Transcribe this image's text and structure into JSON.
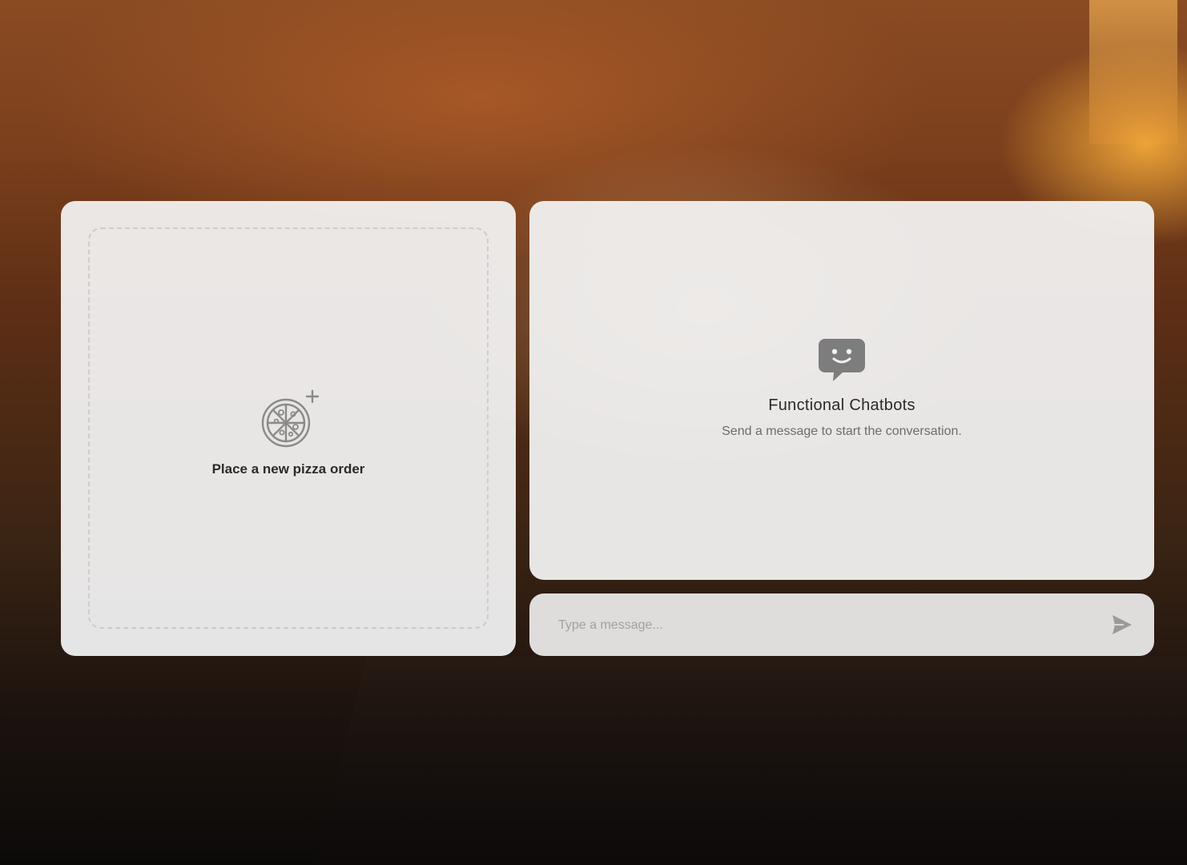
{
  "order_panel": {
    "label": "Place a new pizza order",
    "icon": "pizza-add-icon"
  },
  "chat_panel": {
    "icon": "chatbot-smile-icon",
    "title": "Functional Chatbots",
    "subtitle": "Send a message to start the conversation."
  },
  "composer": {
    "value": "",
    "placeholder": "Type a message...",
    "send_icon": "send-icon"
  },
  "colors": {
    "panel": "#f2f2f2",
    "icon": "#7d7d7d",
    "text_dark": "#2a2a2a",
    "text_muted": "#6c6c6c",
    "placeholder": "#a1a1a1"
  }
}
